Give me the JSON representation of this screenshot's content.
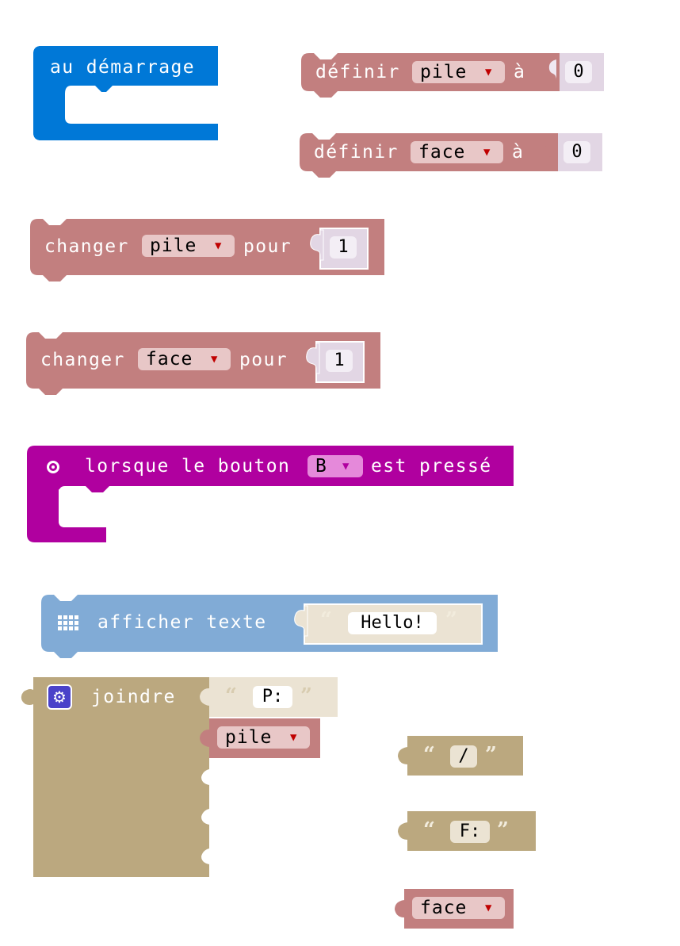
{
  "colors": {
    "events_blue": "#0078d7",
    "variables": "#c27f7f",
    "variables_field": "#e8c7c7",
    "number_slot": "#e2d6e4",
    "input_purple": "#b0009f",
    "input_field": "#e589da",
    "basic_blue": "#81abd6",
    "text_tan": "#bba87f",
    "text_slot_light": "#ebe3d3"
  },
  "on_start": {
    "label": "au démarrage"
  },
  "set_pile": {
    "label": "définir",
    "variable": "pile",
    "to": "à",
    "value": "0"
  },
  "set_face": {
    "label": "définir",
    "variable": "face",
    "to": "à",
    "value": "0"
  },
  "change_pile": {
    "label": "changer",
    "variable": "pile",
    "by": "pour",
    "value": "1"
  },
  "change_face": {
    "label": "changer",
    "variable": "face",
    "by": "pour",
    "value": "1"
  },
  "button_event": {
    "label": "lorsque le bouton",
    "button": "B",
    "suffix": "est pressé",
    "icon": "radio-button-icon"
  },
  "show_string": {
    "label": "afficher texte",
    "value": "Hello!",
    "icon": "led-grid-icon"
  },
  "join": {
    "label": "joindre",
    "first_text": "P:",
    "second_variable": "pile",
    "icon": "gear-icon"
  },
  "loose_text_1": {
    "value": "/"
  },
  "loose_text_2": {
    "value": "F:"
  },
  "loose_variable": {
    "variable": "face"
  },
  "dropdown_arrow": "▼",
  "open_quote": "“",
  "close_quote": "”"
}
